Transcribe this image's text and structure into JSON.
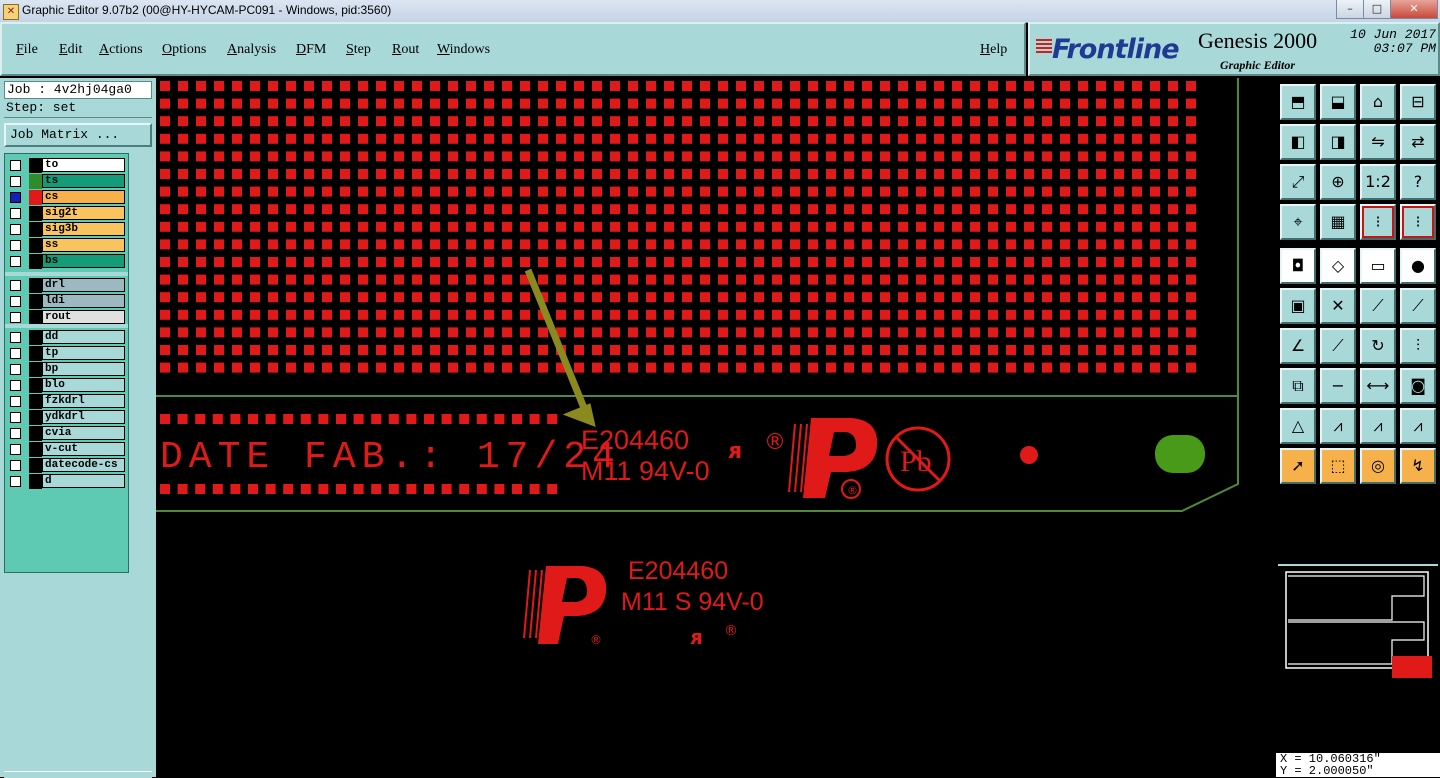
{
  "window": {
    "title": "Graphic Editor 9.07b2 (00@HY-HYCAM-PC091 - Windows, pid:3560)",
    "controls": [
      "minimize",
      "maximize",
      "close"
    ]
  },
  "menu": {
    "items": [
      "File",
      "Edit",
      "Actions",
      "Options",
      "Analysis",
      "DFM",
      "Step",
      "Rout",
      "Windows"
    ],
    "help": "Help"
  },
  "logo": {
    "brand": "Frontline",
    "product": "Genesis 2000",
    "subtitle": "Graphic Editor",
    "date": "10 Jun 2017",
    "time": "03:07 PM"
  },
  "job": {
    "job_label": "Job : 4v2hj04ga0",
    "step_label": "Step: set",
    "matrix_button": "Job Matrix ..."
  },
  "layers": {
    "board": [
      {
        "name": "to",
        "color": "#ffffff",
        "swatch": "#000000",
        "active": false
      },
      {
        "name": "ts",
        "color": "#139c77",
        "swatch": "#2e8b2e",
        "active": false
      },
      {
        "name": "cs",
        "color": "#f6b14a",
        "swatch": "#e01919",
        "active": true
      },
      {
        "name": "sig2t",
        "color": "#f9c45e",
        "swatch": "#000000",
        "active": false
      },
      {
        "name": "sig3b",
        "color": "#f9c45e",
        "swatch": "#000000",
        "active": false
      },
      {
        "name": "ss",
        "color": "#f9c45e",
        "swatch": "#000000",
        "active": false
      },
      {
        "name": "bs",
        "color": "#139c77",
        "swatch": "#000000",
        "active": false
      }
    ],
    "drill": [
      {
        "name": "drl",
        "color": "#9cb8c0"
      },
      {
        "name": "ldi",
        "color": "#9cb8c0"
      },
      {
        "name": "rout",
        "color": "#e0e0e0"
      }
    ],
    "misc": [
      {
        "name": "dd",
        "color": "#a8d8d8"
      },
      {
        "name": "tp",
        "color": "#a8d8d8"
      },
      {
        "name": "bp",
        "color": "#a8d8d8"
      },
      {
        "name": "blo",
        "color": "#a8d8d8"
      },
      {
        "name": "fzkdrl",
        "color": "#a8d8d8"
      },
      {
        "name": "ydkdrl",
        "color": "#a8d8d8"
      },
      {
        "name": "cvia",
        "color": "#a8d8d8"
      },
      {
        "name": "v-cut",
        "color": "#a8d8d8"
      },
      {
        "name": "datecode-cs",
        "color": "#a8d8d8"
      },
      {
        "name": "d",
        "color": "#a8d8d8"
      }
    ]
  },
  "canvas": {
    "date_text": "DATE FAB.: 17/24",
    "ul_number": "E204460",
    "ul_grade": "M11 94V-0",
    "ul_number_2": "E204460",
    "ul_grade_2": "M11 S 94V-0",
    "pb_label": "Pb",
    "registered": "®",
    "colors": {
      "copper": "#e01919",
      "outline": "#4f8a3a",
      "arrow": "#8a8a1e",
      "fiducial": "#4a9a1a"
    }
  },
  "toolbar": {
    "rows": [
      [
        "home-up-icon",
        "home-down-icon",
        "house-icon",
        "window-split-icon"
      ],
      [
        "pan-left-icon",
        "pan-right-icon",
        "mirror-icon",
        "step-flip-icon"
      ],
      [
        "zoom-fit-icon",
        "zoom-in-icon",
        "scale-1-2-icon",
        "help-question-icon"
      ],
      [
        "snap-icon",
        "grid-icon",
        "layers-red-icon",
        "layers-red-2-icon"
      ],
      [
        "pad-icon",
        "polygon-icon",
        "ruler-icon",
        "dot-icon"
      ],
      [
        "select-blue-icon",
        "cross-delete-icon",
        "line-red-icon",
        "line-blue-icon"
      ],
      [
        "angle-icon",
        "diagonal-icon",
        "rotate-icon",
        "feature-icon"
      ],
      [
        "move-copy-icon",
        "minus-icon",
        "measure-icon",
        "multi-pad-icon"
      ],
      [
        "triangle-icon",
        "triangle-a-icon",
        "triangle-b-icon",
        "triangle-c-icon"
      ],
      [
        "pointer-icon",
        "pointer-box-icon",
        "pointer-circle-icon",
        "pointer-path-icon"
      ]
    ],
    "labels": {
      "scale": "1:2",
      "question": "?"
    }
  },
  "status": {
    "x_coord": "X = 10.060316\"",
    "y_coord": "Y = 2.000050\""
  }
}
